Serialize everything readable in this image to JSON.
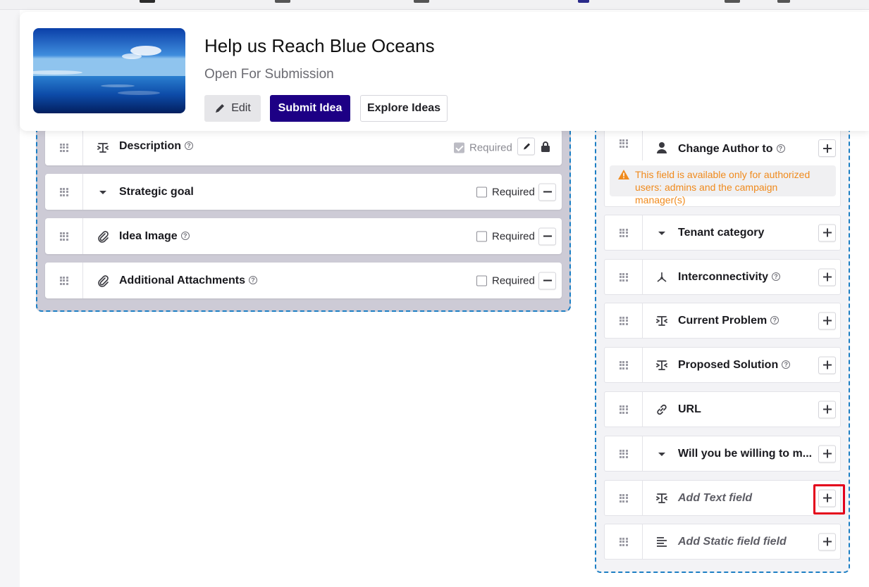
{
  "campaign": {
    "title": "Help us Reach Blue Oceans",
    "status": "Open For Submission",
    "buttons": {
      "edit": "Edit",
      "submit": "Submit Idea",
      "explore": "Explore Ideas"
    }
  },
  "form_fields": [
    {
      "label": "Description",
      "icon": "text-field-icon",
      "help": true,
      "required_label": "Required",
      "required_checked": true,
      "locked": true
    },
    {
      "label": "Strategic goal",
      "icon": "dropdown-icon",
      "help": false,
      "required_label": "Required",
      "required_checked": false
    },
    {
      "label": "Idea Image",
      "icon": "paperclip-icon",
      "help": true,
      "required_label": "Required",
      "required_checked": false
    },
    {
      "label": "Additional Attachments",
      "icon": "paperclip-icon",
      "help": true,
      "required_label": "Required",
      "required_checked": false
    }
  ],
  "palette": {
    "change_author": {
      "label": "Change Author to",
      "warning": "This field is available only for authorized users: admins and the campaign manager(s)"
    },
    "items": [
      {
        "label": "Tenant category",
        "icon": "dropdown-icon"
      },
      {
        "label": "Interconnectivity",
        "icon": "network-icon",
        "help": true
      },
      {
        "label": "Current Problem",
        "icon": "text-field-icon",
        "help": true
      },
      {
        "label": "Proposed Solution",
        "icon": "text-field-icon",
        "help": true
      },
      {
        "label": "URL",
        "icon": "link-icon"
      },
      {
        "label": "Will you be willing to m...",
        "icon": "dropdown-icon"
      },
      {
        "label": "Add Text field",
        "icon": "text-field-icon",
        "placeholder": true
      },
      {
        "label": "Add Static field field",
        "icon": "paragraph-icon",
        "placeholder": true
      }
    ]
  },
  "colors": {
    "primary": "#1d0085",
    "dashed_border": "#1d7fc4",
    "warning_text": "#f08a1c",
    "highlight": "#e3001b"
  }
}
